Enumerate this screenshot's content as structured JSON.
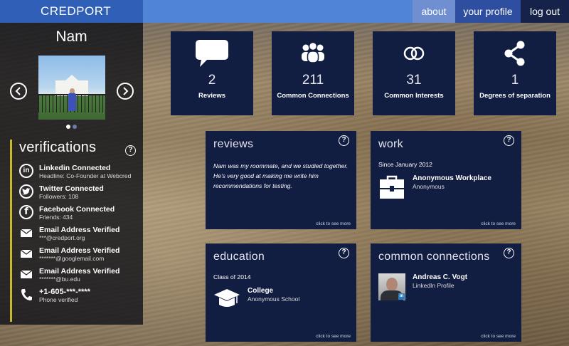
{
  "app": {
    "brand": "CREDPORT"
  },
  "nav": {
    "about": "about",
    "profile": "your profile",
    "logout": "log out"
  },
  "profile": {
    "name": "Nam"
  },
  "verifications": {
    "title": "verifications",
    "help": "?",
    "items": [
      {
        "icon": "linkedin-icon",
        "title": "Linkedin Connected",
        "sub": "Headline: Co-Founder at Webcred"
      },
      {
        "icon": "twitter-icon",
        "title": "Twitter Connected",
        "sub": "Followers: 108"
      },
      {
        "icon": "facebook-icon",
        "title": "Facebook Connected",
        "sub": "Friends: 434"
      },
      {
        "icon": "envelope-icon",
        "title": "Email Address Verified",
        "sub": "***@credport.org"
      },
      {
        "icon": "envelope-icon",
        "title": "Email Address Verified",
        "sub": "*******@googlemail.com"
      },
      {
        "icon": "envelope-icon",
        "title": "Email Address Verified",
        "sub": "*******@bu.edu"
      },
      {
        "icon": "phone-icon",
        "title": "+1-605-***-****",
        "sub": "Phone verified"
      }
    ]
  },
  "stats": [
    {
      "icon": "speech-bubble-icon",
      "value": "2",
      "label": "Reviews"
    },
    {
      "icon": "people-group-icon",
      "value": "211",
      "label": "Common Connections"
    },
    {
      "icon": "rings-icon",
      "value": "31",
      "label": "Common Interests"
    },
    {
      "icon": "share-icon",
      "value": "1",
      "label": "Degrees of separation"
    }
  ],
  "cards": {
    "more": "click to see more",
    "reviews": {
      "title": "reviews",
      "quote": "Nam was my roommate, and we studied together. He's very good at making me write him recommendations for testing."
    },
    "work": {
      "title": "work",
      "since": "Since January 2012",
      "name": "Anonymous Workplace",
      "sub": "Anonymous"
    },
    "education": {
      "title": "education",
      "since": "Class of 2014",
      "name": "College",
      "sub": "Anonymous School"
    },
    "connections": {
      "title": "common connections",
      "name": "Andreas C. Vogt",
      "sub": "LinkedIn Profile",
      "badge": "in"
    }
  }
}
